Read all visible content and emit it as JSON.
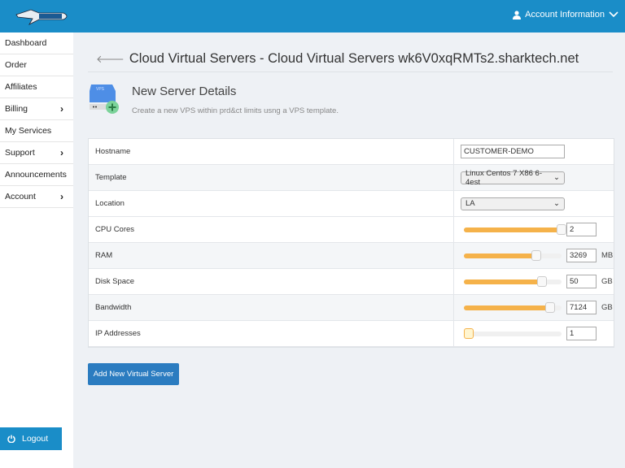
{
  "header": {
    "logo_text": "SHARKTECH",
    "account_label": "Account Information",
    "brand_color": "#1a8dc8"
  },
  "sidebar": {
    "items": [
      {
        "label": "Dashboard",
        "chevron": false
      },
      {
        "label": "Order",
        "chevron": false
      },
      {
        "label": "Affiliates",
        "chevron": false
      },
      {
        "label": "Billing",
        "chevron": true
      },
      {
        "label": "My Services",
        "chevron": false
      },
      {
        "label": "Support",
        "chevron": true
      },
      {
        "label": "Announcements",
        "chevron": false
      },
      {
        "label": "Account",
        "chevron": true
      }
    ],
    "logout_label": "Logout"
  },
  "main": {
    "title": "Cloud Virtual Servers - Cloud Virtual Servers wk6V0xqRMTs2.sharktech.net",
    "section_title": "New Server Details",
    "section_subtitle": "Create a new VPS within prd&ct limits usng a VPS template.",
    "icon_label": "VPS",
    "form": {
      "hostname": {
        "label": "Hostname",
        "value": "CUSTOMER-DEMO"
      },
      "template": {
        "label": "Template",
        "value": "Linux Centos 7 X86 6-4est"
      },
      "location": {
        "label": "Location",
        "value": "LA"
      },
      "cpu": {
        "label": "CPU Cores",
        "value": "2",
        "fraction": 1.0,
        "unit": ""
      },
      "ram": {
        "label": "RAM",
        "value": "3269",
        "fraction": 0.74,
        "unit": "MB"
      },
      "disk": {
        "label": "Disk Space",
        "value": "50",
        "fraction": 0.8,
        "unit": "GB"
      },
      "bandwidth": {
        "label": "Bandwidth",
        "value": "7124",
        "fraction": 0.88,
        "unit": "GB"
      },
      "ip": {
        "label": "IP Addresses",
        "value": "1",
        "fraction": 0,
        "unit": ""
      }
    },
    "submit_label": "Add New Virtual Server"
  }
}
